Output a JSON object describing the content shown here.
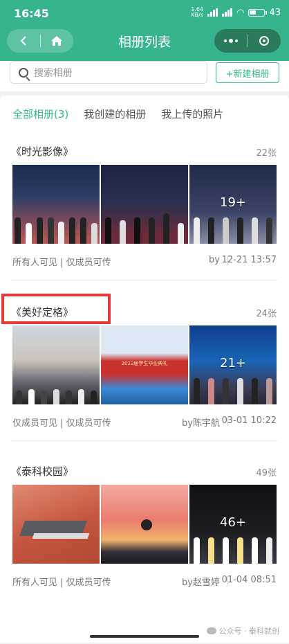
{
  "status_bar": {
    "time": "16:45",
    "net_speed_value": "1.64",
    "net_speed_unit": "KB/s",
    "battery": "43"
  },
  "nav": {
    "title": "相册列表",
    "back_icon": "chevron-left-icon",
    "home_icon": "home-icon",
    "more_icon": "more-dots-icon",
    "close_icon": "target-icon"
  },
  "search": {
    "placeholder": "搜索相册",
    "new_album_label": "+新建相册"
  },
  "tabs": [
    {
      "label": "全部相册(3)",
      "active": true
    },
    {
      "label": "我创建的相册",
      "active": false
    },
    {
      "label": "我上传的照片",
      "active": false
    }
  ],
  "albums": [
    {
      "title": "《时光影像》",
      "count": "22张",
      "more_badge": "19+",
      "permission": "所有人可见 | 仅成员可传",
      "by": "by",
      "date": "12-21 13:57"
    },
    {
      "title": "《美好定格》",
      "count": "24张",
      "more_badge": "21+",
      "permission": "仅成员可见 | 仅成员可传",
      "by": "by陈宇航",
      "date": "03-01 10:22",
      "photo_banner_text": "2023届学生毕业典礼"
    },
    {
      "title": "《泰科校园》",
      "count": "49张",
      "more_badge": "46+",
      "permission": "所有人可见 | 仅成员可传",
      "by": "by赵雪婷",
      "date": "01-04 08:51"
    }
  ],
  "watermark": "公众号 · 泰科就创",
  "colors": {
    "primary": "#35b48e",
    "highlight": "#e53935"
  }
}
